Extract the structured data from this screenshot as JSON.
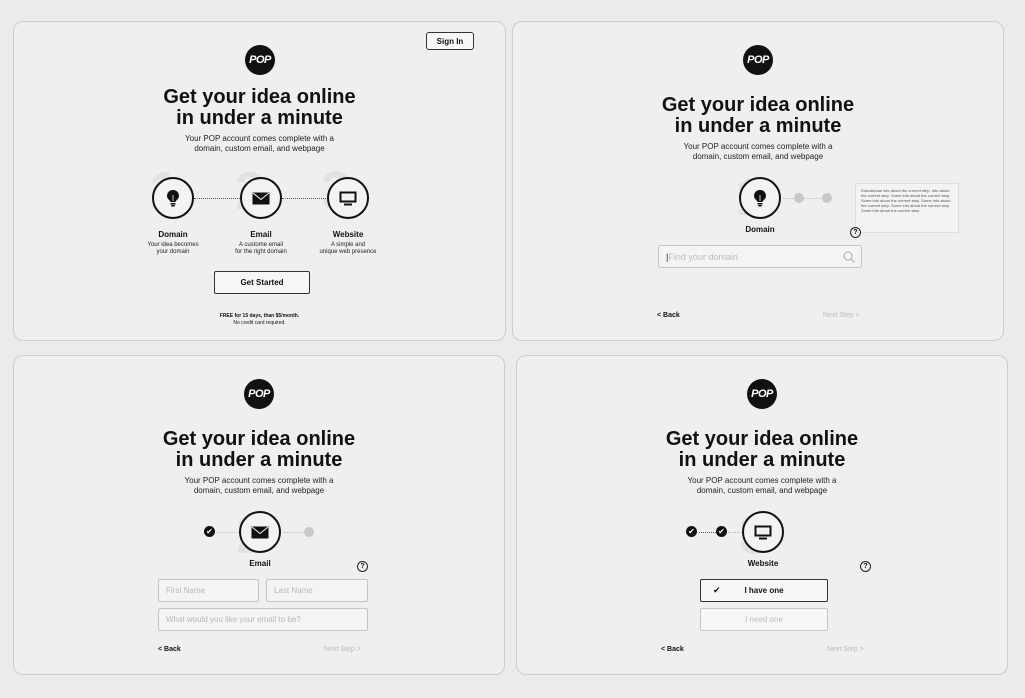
{
  "brand": {
    "logo_text": "POP"
  },
  "hero": {
    "headline_line1": "Get your idea online",
    "headline_line2": "in under a minute",
    "sub_line1": "Your POP account comes complete with a",
    "sub_line2": "domain, custom email, and webpage"
  },
  "header": {
    "sign_in_label": "Sign In"
  },
  "steps": [
    {
      "number": "1",
      "label": "Domain",
      "desc_line1": "Your idea becomes",
      "desc_line2": "your domain",
      "icon": "lightbulb-icon"
    },
    {
      "number": "2",
      "label": "Email",
      "desc_line1": "A custome email",
      "desc_line2": "for the right domain",
      "icon": "envelope-icon"
    },
    {
      "number": "3",
      "label": "Website",
      "desc_line1": "A simple and",
      "desc_line2": "unique web presence",
      "icon": "monitor-icon"
    }
  ],
  "intro": {
    "cta_label": "Get Started",
    "pricing_line": "FREE for 15 days, than $5/month.",
    "pricing_note": "No credit card required."
  },
  "domain_step": {
    "search_placeholder": "Find your domain",
    "tooltip_text": "Educational info about the current step. Info about the current step. Some info about the current step. Some info about the current step. Some info about the current step. Some info about the current step. Some info about the current step."
  },
  "email_step": {
    "first_name_placeholder": "First Name",
    "last_name_placeholder": "Last Name",
    "email_placeholder": "What would you like your email to be?"
  },
  "website_step": {
    "have_one_label": "I have one",
    "need_one_label": "I need one"
  },
  "nav": {
    "back_label": "< Back",
    "next_label": "Next Step >"
  },
  "help_glyph": "?",
  "check_glyph": "✔",
  "colors": {
    "ink": "#111111",
    "muted": "#bbbbbb",
    "panel": "#efefef",
    "background": "#ebebeb"
  }
}
